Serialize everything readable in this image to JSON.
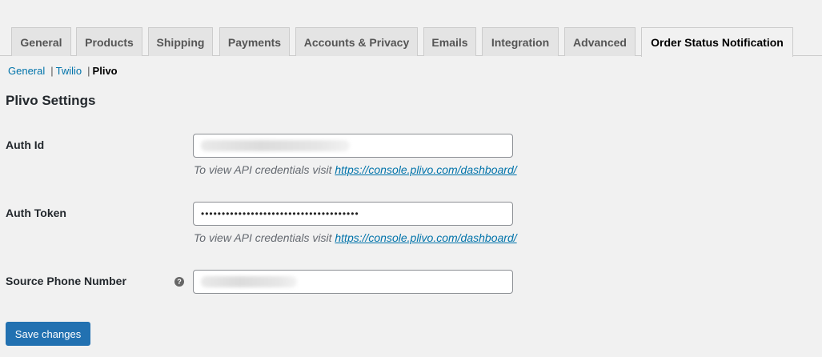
{
  "tabs": [
    {
      "label": "General"
    },
    {
      "label": "Products"
    },
    {
      "label": "Shipping"
    },
    {
      "label": "Payments"
    },
    {
      "label": "Accounts & Privacy"
    },
    {
      "label": "Emails"
    },
    {
      "label": "Integration"
    },
    {
      "label": "Advanced"
    },
    {
      "label": "Order Status Notification",
      "active": true
    }
  ],
  "subnav": {
    "items": [
      "General",
      "Twilio",
      "Plivo"
    ],
    "separator": "|",
    "current": "Plivo"
  },
  "section": {
    "title": "Plivo Settings"
  },
  "fields": {
    "auth_id": {
      "label": "Auth Id",
      "value_obscured": true,
      "description_prefix": "To view API credentials visit",
      "description_link": "https://console.plivo.com/dashboard/"
    },
    "auth_token": {
      "label": "Auth Token",
      "masked_value": "••••••••••••••••••••••••••••••••••••••",
      "description_prefix": "To view API credentials visit",
      "description_link": "https://console.plivo.com/dashboard/"
    },
    "source_phone": {
      "label": "Source Phone Number",
      "value_obscured": true,
      "help_icon": "question-circle-icon",
      "help_icon_glyph": "?"
    }
  },
  "actions": {
    "save_label": "Save changes"
  },
  "colors": {
    "background": "#f1f1f1",
    "link": "#0073aa",
    "primary_button": "#2271b1",
    "tab_inactive": "#e4e4e4"
  }
}
